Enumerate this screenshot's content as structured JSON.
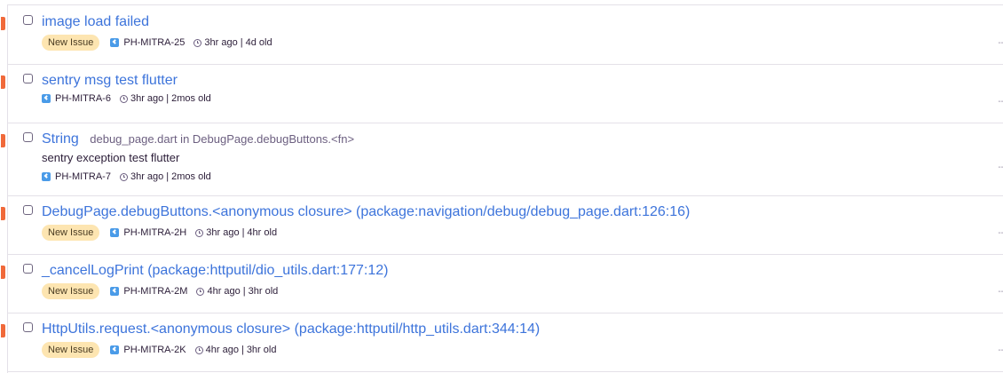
{
  "issues": [
    {
      "title": "image load failed",
      "location": "",
      "subtitle": "",
      "badge": "New Issue",
      "short_id": "PH-MITRA-25",
      "last_seen": "3hr ago",
      "age": "4d old",
      "trend": "--"
    },
    {
      "title": "sentry msg test flutter",
      "location": "",
      "subtitle": "",
      "badge": "",
      "short_id": "PH-MITRA-6",
      "last_seen": "3hr ago",
      "age": "2mos old",
      "trend": "--"
    },
    {
      "title": "String",
      "location": "debug_page.dart in DebugPage.debugButtons.<fn>",
      "subtitle": "sentry exception test flutter",
      "badge": "",
      "short_id": "PH-MITRA-7",
      "last_seen": "3hr ago",
      "age": "2mos old",
      "trend": "--"
    },
    {
      "title": "DebugPage.debugButtons.<anonymous closure> (package:navigation/debug/debug_page.dart:126:16)",
      "location": "",
      "subtitle": "",
      "badge": "New Issue",
      "short_id": "PH-MITRA-2H",
      "last_seen": "3hr ago",
      "age": "4hr old",
      "trend": "--"
    },
    {
      "title": "_cancelLogPrint (package:httputil/dio_utils.dart:177:12)",
      "location": "",
      "subtitle": "",
      "badge": "New Issue",
      "short_id": "PH-MITRA-2M",
      "last_seen": "4hr ago",
      "age": "3hr old",
      "trend": "--"
    },
    {
      "title": "HttpUtils.request.<anonymous closure> (package:httputil/http_utils.dart:344:14)",
      "location": "",
      "subtitle": "",
      "badge": "New Issue",
      "short_id": "PH-MITRA-2K",
      "last_seen": "4hr ago",
      "age": "3hr old",
      "trend": "--"
    }
  ],
  "colors": {
    "level_error": "#f0693a",
    "link": "#3d74db",
    "badge_bg": "#fde5b1",
    "platform_flutter": "#4a9be8"
  },
  "icons": {
    "platform": "flutter-icon",
    "time": "clock-icon"
  }
}
